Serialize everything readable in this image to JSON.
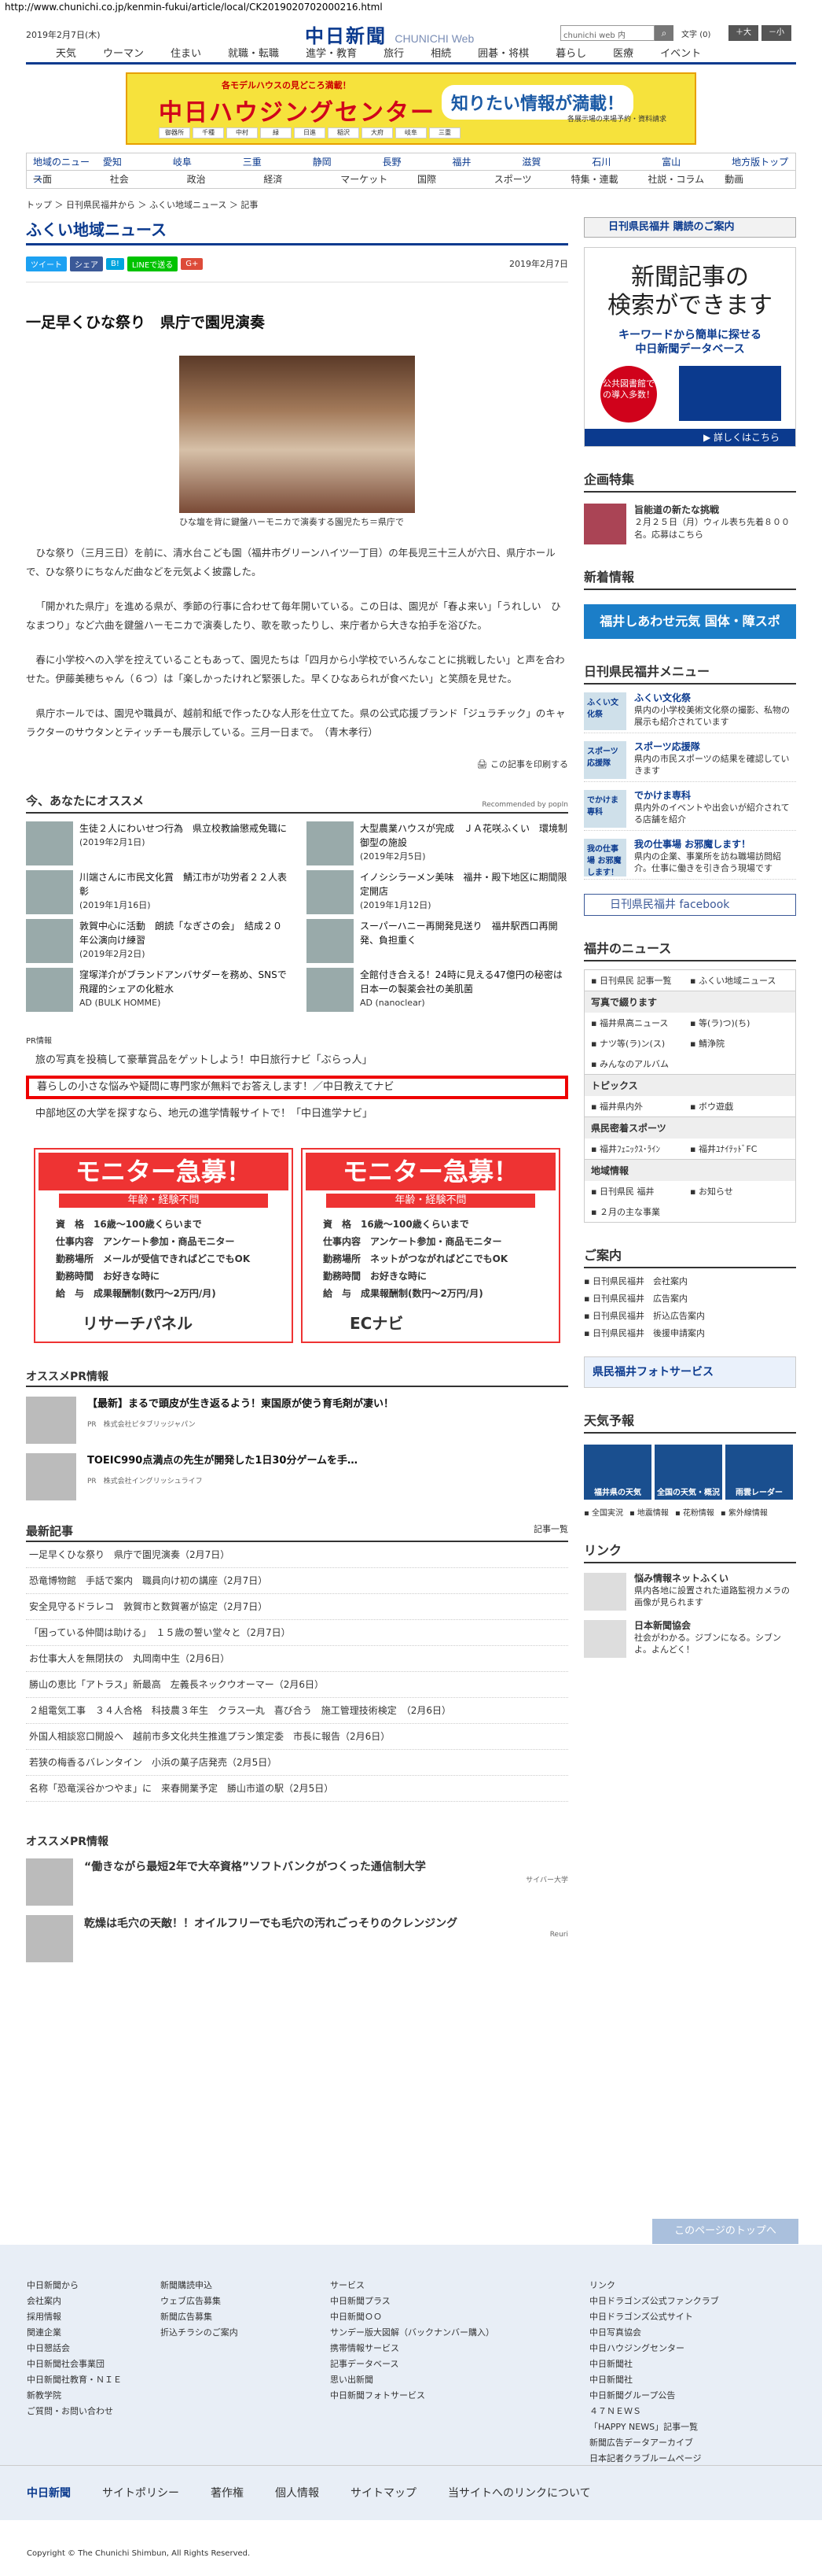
{
  "url": "http://www.chunichi.co.jp/kenmin-fukui/article/local/CK2019020702000216.html",
  "header": {
    "date": "2019年2月7日(木)",
    "logo": "中日新聞",
    "logo_sub": "CHUNICHI Web",
    "search_placeholder": "chunichi web 内",
    "font_label": "文字",
    "font_state": "(0)",
    "font_up": "＋大",
    "font_down": "－小"
  },
  "gnav": [
    "天気",
    "ウーマン",
    "住まい",
    "就職・転職",
    "進学・教育",
    "旅行",
    "相続",
    "囲碁・将棋",
    "暮らし",
    "医療",
    "イベント"
  ],
  "banner": {
    "top": "各モデルハウスの見どころ満載！",
    "main": "中日ハウジングセンター",
    "bubble": "知りたい情報が満載！",
    "sub": "各展示場の来場予約・資料請求",
    "areas": [
      "御器所",
      "千種",
      "中村",
      "緑",
      "日進",
      "稲沢",
      "大府",
      "岐阜",
      "三重"
    ]
  },
  "subnav": {
    "row1": [
      "地域のニュース",
      "愛知",
      "岐阜",
      "三重",
      "静岡",
      "長野",
      "福井",
      "滋賀",
      "石川",
      "富山",
      "地方版トップ"
    ],
    "row2": [
      "一面",
      "社会",
      "政治",
      "経済",
      "マーケット",
      "国際",
      "スポーツ",
      "特集・連載",
      "社説・コラム",
      "動画"
    ]
  },
  "breadcrumb": "トップ ＞ 日刊県民福井から ＞ ふくい地域ニュース ＞ 記事",
  "page_title": "ふくい地域ニュース",
  "share": {
    "tweet": "ツイート",
    "fb": "シェア",
    "hatena": "B!",
    "line": "LINEで送る",
    "g": "G+",
    "date": "2019年2月7日"
  },
  "article": {
    "headline": "一足早くひな祭り　県庁で園児演奏",
    "caption": "ひな壇を背に鍵盤ハーモニカで演奏する園児たち＝県庁で",
    "paras": [
      "ひな祭り（三月三日）を前に、清水台こども園（福井市グリーンハイツ一丁目）の年長児三十三人が六日、県庁ホールで、ひな祭りにちなんだ曲などを元気よく披露した。",
      "「開かれた県庁」を進める県が、季節の行事に合わせて毎年開いている。この日は、園児が「春よ来い」「うれしい　ひなまつり」など六曲を鍵盤ハーモニカで演奏したり、歌を歌ったりし、来庁者から大きな拍手を浴びた。",
      "春に小学校への入学を控えていることもあって、園児たちは「四月から小学校でいろんなことに挑戦したい」と声を合わせた。伊藤美穂ちゃん（６つ）は「楽しかったけれど緊張した。早くひなあられが食べたい」と笑顔を見せた。",
      "県庁ホールでは、園児や職員が、越前和紙で作ったひな人形を仕立てた。県の公式応援ブランド「ジュラチック」のキャラクターのサウタンとティッチーも展示している。三月一日まで。　（青木孝行）"
    ],
    "print": "この記事を印刷する"
  },
  "reco": {
    "title": "今、あなたにオススメ",
    "by": "Recommended by popIn",
    "items": [
      {
        "t": "生徒２人にわいせつ行為　県立校教論懲戒免職に",
        "d": "(2019年2月1日)"
      },
      {
        "t": "大型農業ハウスが完成　ＪＡ花咲ふくい　環境制御型の施設",
        "d": "(2019年2月5日)"
      },
      {
        "t": "川端さんに市民文化賞　鯖江市が功労者２２人表彰",
        "d": "(2019年1月16日)"
      },
      {
        "t": "イノシシラーメン美味　福井・殿下地区に期間限定開店",
        "d": "(2019年1月12日)"
      },
      {
        "t": "敦賀中心に活動　朗読「なぎさの会」　結成２０年公演向け練習",
        "d": "(2019年2月2日)"
      },
      {
        "t": "スーパーハニー再開発見送り　福井駅西口再開発、負担重く",
        "d": ""
      },
      {
        "t": "窪塚洋介がブランドアンバサダーを務め、SNSで飛躍的シェアの化粧水",
        "d": "AD (BULK HOMME)"
      },
      {
        "t": "全館付き合える！24時に見える47億円の秘密は日本一の製薬会社の美肌菌",
        "d": "AD (nanoclear)"
      }
    ]
  },
  "pr": {
    "label": "PR情報",
    "links": [
      "旅の写真を投稿して豪華賞品をゲットしよう！中日旅行ナビ「ぶらっ人」",
      "暮らしの小さな悩みや疑問に専門家が無料でお答えします！／中日教えてナビ",
      "中部地区の大学を探すなら、地元の進学情報サイトで！「中日進学ナビ」"
    ]
  },
  "monitor": [
    {
      "title": "モニター急募！",
      "sub": "年齢・経験不問",
      "rows": [
        "資　格　16歳～100歳くらいまで",
        "仕事内容　アンケート参加・商品モニター",
        "勤務場所　メールが受信できればどこでもOK",
        "勤務時間　お好きな時に",
        "給　与　成果報酬制(数円～2万円/月)"
      ],
      "logo": "リサーチパネル"
    },
    {
      "title": "モニター急募！",
      "sub": "年齢・経験不問",
      "rows": [
        "資　格　16歳～100歳くらいまで",
        "仕事内容　アンケート参加・商品モニター",
        "勤務場所　ネットがつながればどこでもOK",
        "勤務時間　お好きな時に",
        "給　与　成果報酬制(数円～2万円/月)"
      ],
      "logo": "ECナビ"
    }
  ],
  "osusume_pr": {
    "title": "オススメPR情報",
    "items": [
      {
        "t": "【最新】まるで頭皮が生き返るよう！東国原が使う育毛剤が凄い！",
        "s": "PR　株式会社ピタブリッジャパン"
      },
      {
        "t": "TOEIC990点満点の先生が開発した1日30分ゲームを手…",
        "s": "PR　株式会社イングリッシュライフ"
      }
    ]
  },
  "latest": {
    "title": "最新記事",
    "more": "記事一覧",
    "items": [
      "一足早くひな祭り　県庁で園児演奏（2月7日）",
      "恐竜博物館　手話で案内　職員向け初の講座（2月7日）",
      "安全見守るドラレコ　敦賀市と数賀署が協定（2月7日）",
      "「困っている仲間は助ける」　１５歳の誓い堂々と（2月7日）",
      "お仕事大人を無閉扶の　丸岡南中生（2月6日）",
      "勝山の恵比「アトラス」新最高　左義長ネックウオーマー（2月6日）",
      "２組電気工事　３４人合格　科技農３年生　クラス一丸　喜び合う　施工管理技術検定　（2月6日）",
      "外国人相談窓口開設へ　越前市多文化共生推進プラン策定委　市長に報告（2月6日）",
      "若狭の梅香るバレンタイン　小浜の菓子店発売（2月5日）",
      "名称「恐竜渓谷かつやま」に　来春開業予定　勝山市道の駅（2月5日）"
    ]
  },
  "osusume2": {
    "title": "オススメPR情報",
    "items": [
      {
        "t": "“働きながら最短2年で大卒資格”ソフトバンクがつくった通信制大学",
        "s": "サイバー大学"
      },
      {
        "t": "乾燥は毛穴の天敵！！オイルフリーでも毛穴の汚れごっそりのクレンジング",
        "s": "Reuri"
      }
    ]
  },
  "right": {
    "kodoku": "日刊県民福井 購読のご案内",
    "ad": {
      "line1": "新聞記事の",
      "line2": "検索ができます",
      "line3": "キーワードから簡単に探せる",
      "line4": "中日新聞データベース",
      "circle": "公共図書館での導入多数！",
      "more": "▶ 詳しくはこちら"
    },
    "kikaku": "企画特集",
    "kikaku_item": {
      "t": "旨能道の新たな挑戦",
      "d": "２月２５日（月）ウィル表ち先着８００名。応募はこちら"
    },
    "shinchaku": "新着情報",
    "shinchaku_banner": "福井しあわせ元気 国体・障スポ 2018",
    "menu_title": "日刊県民福井メニュー",
    "menu": [
      {
        "b": "ふくい文化祭",
        "t": "県内の小学校美術文化祭の撮影、私物の展示も紹介されています"
      },
      {
        "b": "スポーツ応援隊",
        "t": "県内の市民スポーツの結果を確認していきます"
      },
      {
        "b": "でかけま専科",
        "t": "県内外のイベントや出会いが紹介されてる店舗を紹介"
      },
      {
        "b": "我の仕事場 お邪魔します！",
        "t": "県内の企業、事業所を訪ね職場訪問紹介。仕事に働きを引き合う現場です"
      }
    ],
    "facebook": "日刊県民福井 facebook",
    "news_title": "福井のニュース",
    "news": {
      "r1": [
        "日刊県民 記事一覧",
        "ふくい地域ニュース"
      ],
      "h1": "写真で綴ります",
      "r2": [
        "福井県高ニュース",
        "等(ラ)つ)(ち)"
      ],
      "r3": [
        "ナツ等(ラ)ン(ス)",
        "鯖浄院"
      ],
      "r4": [
        "みんなのアルバム",
        ""
      ],
      "h2": "トピックス",
      "r5": [
        "福井県内外",
        "ボウ遊戯"
      ],
      "h3": "県民密着スポーツ",
      "r6": [
        "福井ﾌｪﾆｯｸｽ･ﾗｲﾝ",
        "福井ﾕﾅｲﾃｯﾄﾞFC"
      ],
      "h4": "地域情報",
      "r7": [
        "日刊県民 福井",
        "お知らせ"
      ],
      "r8": [
        "２月の主な事業",
        ""
      ]
    },
    "goannai": "ご案内",
    "goannai_items": [
      "日刊県民福井　会社案内",
      "日刊県民福井　広告案内",
      "日刊県民福井　折込広告案内",
      "日刊県民福井　後援申請案内"
    ],
    "photo_service": "県民福井フォトサービス",
    "tenki": "天気予報",
    "tenki_items": [
      "福井県の天気",
      "全国の天気・概況",
      "雨雲レーダー"
    ],
    "tenki_links": [
      "全国実況",
      "地震情報",
      "花粉情報",
      "紫外線情報"
    ],
    "link_title": "リンク",
    "links": [
      {
        "b": "悩み情報ネットふくい",
        "t": "県内各地に設置された道路監視カメラの画像が見られます"
      },
      {
        "b": "日本新聞協会",
        "t": "社会がわかる。ジブンになる。シブンよ。よんどく！"
      }
    ]
  },
  "pagetop": "このページのトップへ",
  "footer": {
    "c1": [
      "中日新聞から",
      "会社案内",
      "採用情報",
      "関連企業",
      "中日懇話会",
      "中日新聞社会事業団",
      "中日新聞社教育・ＮＩＥ",
      "新教学院",
      "ご質問・お問い合わせ"
    ],
    "c2": [
      "",
      "新聞購読申込",
      "ウェブ広告募集",
      "新聞広告募集",
      "折込チラシのご案内"
    ],
    "c3": [
      "サービス",
      "中日新聞プラス",
      "中日新聞ＯＯ",
      "サンデー版大図解（バックナンバー購入）",
      "携帯情報サービス",
      "記事データベース",
      "思い出新聞",
      "中日新聞フォトサービス"
    ],
    "c4": [
      "リンク",
      "中日ドラゴンズ公式ファンクラブ",
      "中日ドラゴンズ公式サイト",
      "中日写真協会",
      "中日ハウジングセンター",
      "中日新聞社",
      "中日新聞社",
      "中日新聞グループ公告",
      "４７ＮＥＷＳ",
      "「HAPPY NEWS」記事一覧",
      "新聞広告データアーカイブ",
      "日本記者クラブルームページ"
    ]
  },
  "bottom": [
    "中日新聞",
    "サイトポリシー",
    "著作権",
    "個人情報",
    "サイトマップ",
    "当サイトへのリンクについて"
  ],
  "copyright": "Copyright © The Chunichi Shimbun, All Rights Reserved."
}
